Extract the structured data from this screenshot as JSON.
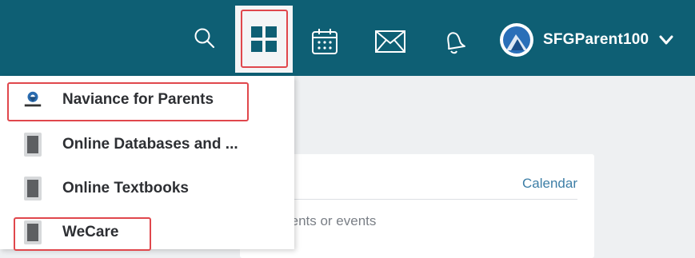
{
  "header": {
    "username": "SFGParent100",
    "icons": {
      "search": "search-icon",
      "apps": "apps-grid-icon",
      "calendar": "calendar-icon",
      "mail": "mail-icon",
      "notifications": "bell-icon",
      "account_menu": "chevron-down-icon"
    },
    "colors": {
      "bar": "#0e5f74",
      "highlight": "#e0474c"
    }
  },
  "apps_menu": {
    "items": [
      {
        "label": "Naviance for Parents",
        "icon": "naviance-logo-icon"
      },
      {
        "label": "Online Databases and ...",
        "icon": "app-placeholder-icon"
      },
      {
        "label": "Online Textbooks",
        "icon": "app-placeholder-icon"
      },
      {
        "label": "WeCare",
        "icon": "app-placeholder-icon"
      }
    ]
  },
  "card": {
    "link": "Calendar",
    "empty_text": "nments or events"
  }
}
